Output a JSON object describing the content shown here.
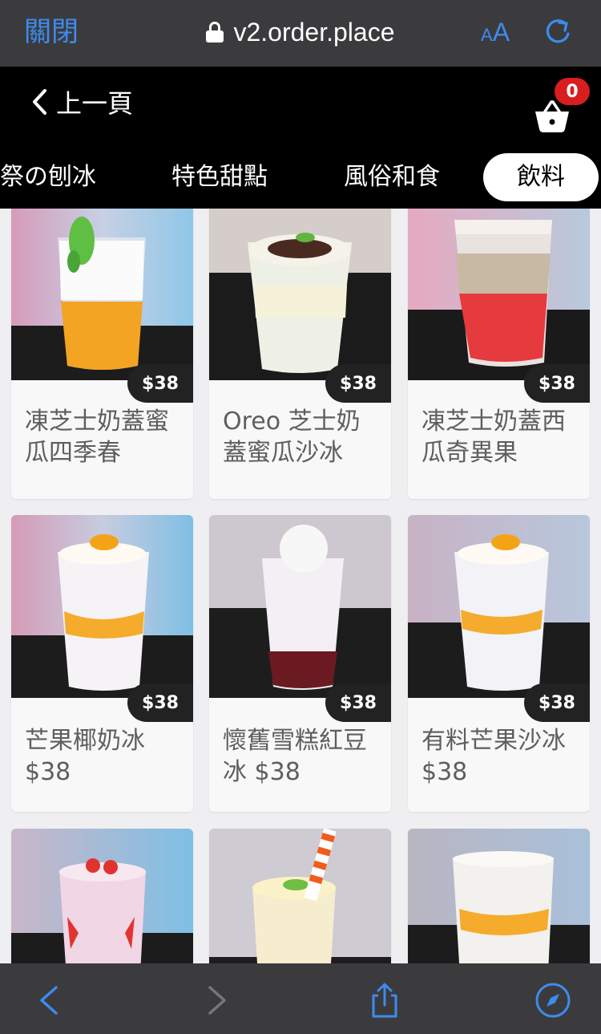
{
  "browser": {
    "close_label": "關閉",
    "url": "v2.order.place",
    "aa_small": "A",
    "aa_big": "A"
  },
  "header": {
    "back_label": "上一頁",
    "cart_count": "0"
  },
  "tabs": [
    {
      "label": "祭の刨冰"
    },
    {
      "label": "特色甜點"
    },
    {
      "label": "風俗和食"
    },
    {
      "label": "飲料"
    }
  ],
  "products": [
    {
      "name": "凍芝士奶蓋蜜瓜四季春",
      "price": "$38"
    },
    {
      "name": "Oreo 芝士奶蓋蜜瓜沙冰",
      "price": "$38"
    },
    {
      "name": "凍芝士奶蓋西瓜奇異果",
      "price": "$38"
    },
    {
      "name": "芒果椰奶冰 $38",
      "price": "$38"
    },
    {
      "name": "懷舊雪糕紅豆冰 $38",
      "price": "$38"
    },
    {
      "name": "有料芒果沙冰 $38",
      "price": "$38"
    }
  ],
  "colors": {
    "accent": "#3d8bf0",
    "badge": "#d81e1e",
    "chrome": "#3b3b3d"
  }
}
